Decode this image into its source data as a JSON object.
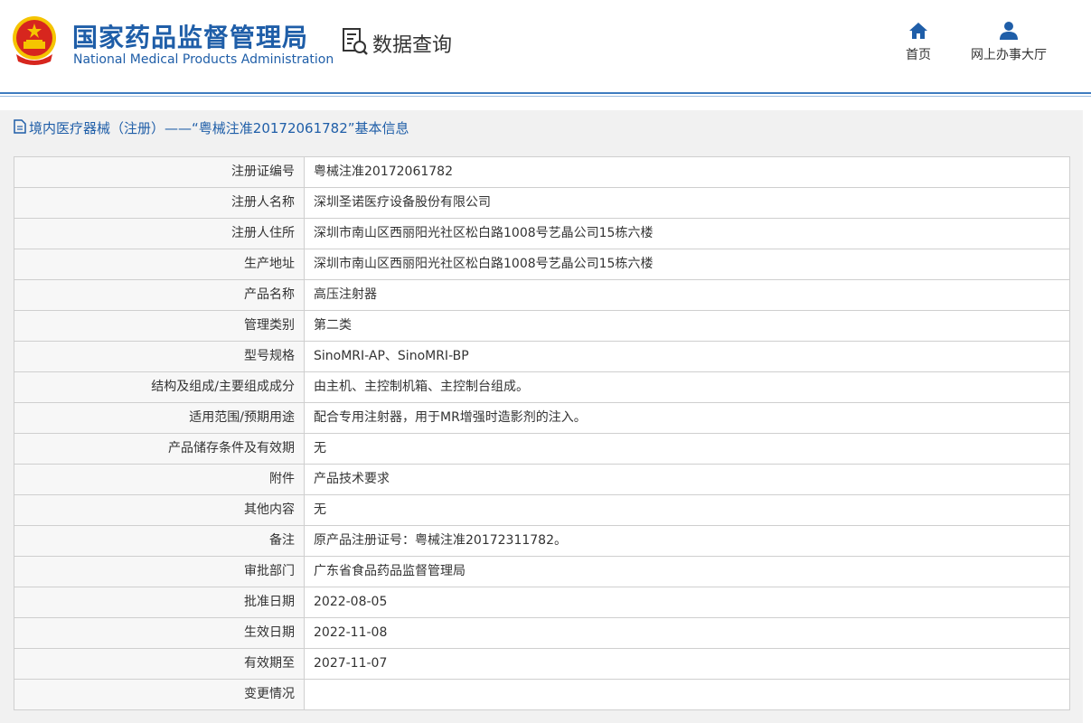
{
  "header": {
    "title_cn": "国家药品监督管理局",
    "title_en": "National Medical Products Administration",
    "query_label": "数据查询",
    "nav": [
      {
        "label": "首页",
        "icon": "home-icon"
      },
      {
        "label": "网上办事大厅",
        "icon": "user-icon"
      }
    ]
  },
  "colors": {
    "brand_blue": "#1f5ea8",
    "emblem_red": "#d7261e",
    "emblem_gold": "#f5c400"
  },
  "panel": {
    "title": "境内医疗器械（注册）——“粤械注准20172061782”基本信息"
  },
  "table": {
    "rows": [
      {
        "label": "注册证编号",
        "value": "粤械注准20172061782"
      },
      {
        "label": "注册人名称",
        "value": "深圳圣诺医疗设备股份有限公司"
      },
      {
        "label": "注册人住所",
        "value": "深圳市南山区西丽阳光社区松白路1008号艺晶公司15栋六楼"
      },
      {
        "label": "生产地址",
        "value": "深圳市南山区西丽阳光社区松白路1008号艺晶公司15栋六楼"
      },
      {
        "label": "产品名称",
        "value": "高压注射器"
      },
      {
        "label": "管理类别",
        "value": "第二类"
      },
      {
        "label": "型号规格",
        "value": "SinoMRI-AP、SinoMRI-BP"
      },
      {
        "label": "结构及组成/主要组成成分",
        "value": "由主机、主控制机箱、主控制台组成。"
      },
      {
        "label": "适用范围/预期用途",
        "value": "配合专用注射器，用于MR增强时造影剂的注入。"
      },
      {
        "label": "产品储存条件及有效期",
        "value": "无"
      },
      {
        "label": "附件",
        "value": "产品技术要求"
      },
      {
        "label": "其他内容",
        "value": "无"
      },
      {
        "label": "备注",
        "value": "原产品注册证号：粤械注准20172311782。"
      },
      {
        "label": "审批部门",
        "value": "广东省食品药品监督管理局"
      },
      {
        "label": "批准日期",
        "value": "2022-08-05"
      },
      {
        "label": "生效日期",
        "value": "2022-11-08"
      },
      {
        "label": "有效期至",
        "value": "2027-11-07"
      },
      {
        "label": "变更情况",
        "value": ""
      }
    ]
  }
}
